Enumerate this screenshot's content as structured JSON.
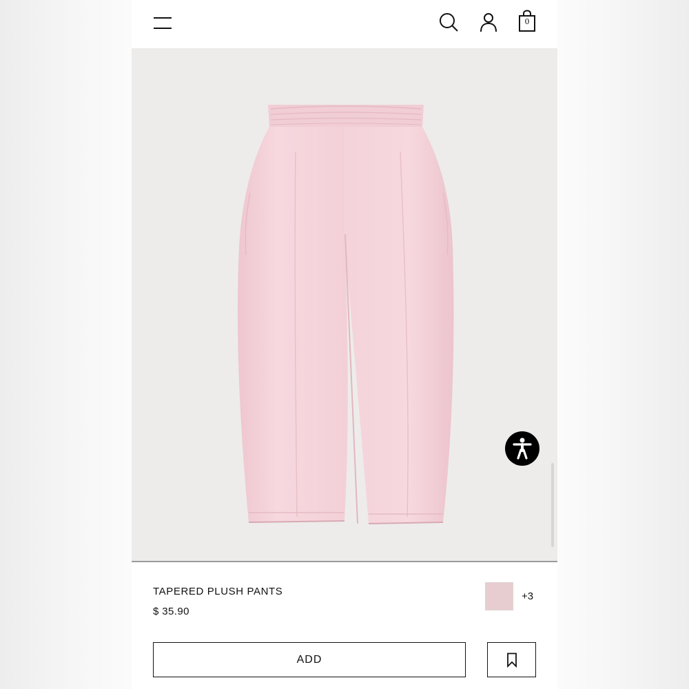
{
  "header": {
    "icons": [
      "menu-icon",
      "search-icon",
      "account-icon",
      "shopping-bag-icon"
    ],
    "cart_count": "0"
  },
  "product": {
    "image_subject": "pink tapered plush pants",
    "name": "TAPERED PLUSH PANTS",
    "price": "$ 35.90",
    "swatch_color": "#e7cdd0",
    "more_colors": "+3"
  },
  "actions": {
    "add_label": "ADD",
    "bookmark_icon": "bookmark-icon"
  },
  "colors": {
    "image_background": "#edeceb",
    "pants": "#f5d3db",
    "accessibility_button": "#000000"
  }
}
